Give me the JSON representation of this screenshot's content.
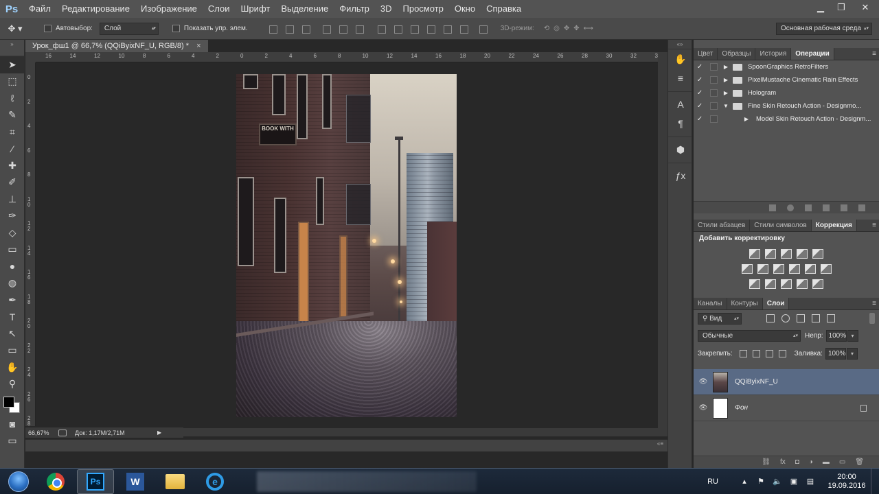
{
  "app": {
    "logo": "Ps"
  },
  "menu": [
    "Файл",
    "Редактирование",
    "Изображение",
    "Слои",
    "Шрифт",
    "Выделение",
    "Фильтр",
    "3D",
    "Просмотр",
    "Окно",
    "Справка"
  ],
  "window_controls": {
    "minimize": "▁",
    "restore": "❐",
    "close": "✕"
  },
  "options_bar": {
    "tool_icon": "move-tool-icon",
    "autoselect_label": "Автовыбор:",
    "autoselect_value": "Слой",
    "show_controls_label": "Показать упр. элем.",
    "mode_3d_label": "3D-режим:",
    "workspace": "Основная рабочая среда"
  },
  "document": {
    "tab_title": "Урок_фш1 @ 66,7% (QQiByixNF_U, RGB/8) *",
    "tab_close": "×",
    "zoom": "66,67%",
    "doc_info": "Док: 1,17M/2,71M",
    "ruler_h": [
      "16",
      "14",
      "12",
      "10",
      "8",
      "6",
      "4",
      "2",
      "0",
      "2",
      "4",
      "6",
      "8",
      "10",
      "12",
      "14",
      "16",
      "18",
      "20",
      "22",
      "24",
      "26",
      "28",
      "30",
      "32",
      "3"
    ],
    "ruler_v": [
      "0",
      "2",
      "4",
      "6",
      "8",
      "1\n0",
      "1\n2",
      "1\n4",
      "1\n6",
      "1\n8",
      "2\n0",
      "2\n2",
      "2\n4",
      "2\n6",
      "2\n8"
    ],
    "sign_text": "BOOK WITH"
  },
  "panels": {
    "top_tabs": [
      "Цвет",
      "Образцы",
      "История",
      "Операции"
    ],
    "top_active": 3,
    "actions": [
      {
        "label": "SpoonGraphics RetroFilters",
        "type": "set",
        "expanded": false
      },
      {
        "label": "PixelMustache Cinematic Rain Effects",
        "type": "set",
        "expanded": false
      },
      {
        "label": "Hologram",
        "type": "set",
        "expanded": false
      },
      {
        "label": "Fine Skin Retouch Action - Designmo...",
        "type": "set",
        "expanded": true
      },
      {
        "label": "Model Skin Retouch Action - Designm...",
        "type": "action",
        "expanded": false
      }
    ],
    "mid_tabs": [
      "Стили абзацев",
      "Стили символов",
      "Коррекция"
    ],
    "mid_active": 2,
    "adjust_title": "Добавить корректировку",
    "layer_tabs": [
      "Каналы",
      "Контуры",
      "Слои"
    ],
    "layer_active": 2,
    "filter_kind": "Вид",
    "blend_mode": "Обычные",
    "opacity_label": "Непр:",
    "opacity": "100%",
    "lock_label": "Закрепить:",
    "fill_label": "Заливка:",
    "fill": "100%",
    "layers": [
      {
        "name": "QQiByixNF_U",
        "selected": true,
        "thumb": "photo",
        "locked": false
      },
      {
        "name": "Фон",
        "selected": false,
        "thumb": "white",
        "locked": true
      }
    ]
  },
  "taskbar": {
    "apps": [
      "chrome-icon",
      "photoshop-icon",
      "word-icon",
      "explorer-icon",
      "ie-icon"
    ],
    "ps_label": "Ps",
    "word_label": "W",
    "ie_label": "e",
    "lang": "RU",
    "time": "20:00",
    "date": "19.09.2016"
  }
}
